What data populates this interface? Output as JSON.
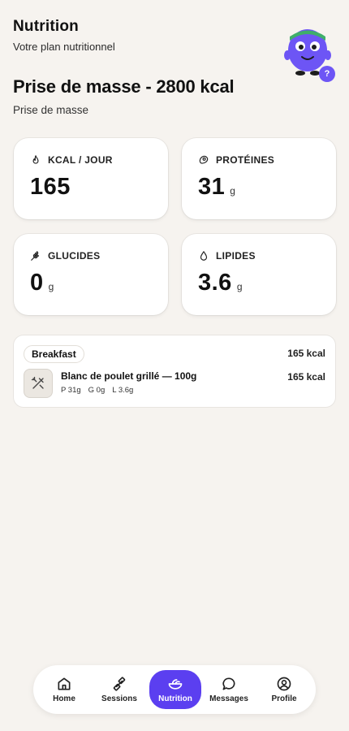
{
  "header": {
    "title": "Nutrition",
    "subtitle": "Votre plan nutritionnel",
    "help_badge": "?"
  },
  "plan": {
    "title": "Prise de masse - 2800 kcal",
    "subtitle": "Prise de masse"
  },
  "stats": [
    {
      "label": "KCAL / JOUR",
      "value": "165",
      "unit": "",
      "icon": "flame-icon"
    },
    {
      "label": "PROTÉINES",
      "value": "31",
      "unit": "g",
      "icon": "meat-icon"
    },
    {
      "label": "GLUCIDES",
      "value": "0",
      "unit": "g",
      "icon": "wheat-icon"
    },
    {
      "label": "LIPIDES",
      "value": "3.6",
      "unit": "g",
      "icon": "droplet-icon"
    }
  ],
  "meal": {
    "name": "Breakfast",
    "total": "165 kcal",
    "items": [
      {
        "name": "Blanc de poulet grillé — 100g",
        "kcal": "165 kcal",
        "protein": "P 31g",
        "carbs": "G 0g",
        "fat": "L 3.6g",
        "icon": "utensils-crossed-icon"
      }
    ]
  },
  "nav": {
    "items": [
      {
        "label": "Home",
        "icon": "home-icon"
      },
      {
        "label": "Sessions",
        "icon": "dumbbell-icon"
      },
      {
        "label": "Nutrition",
        "icon": "salad-bowl-icon"
      },
      {
        "label": "Messages",
        "icon": "chat-bubble-icon"
      },
      {
        "label": "Profile",
        "icon": "user-circle-icon"
      }
    ],
    "active": "Nutrition"
  },
  "colors": {
    "background": "#f6f3ef",
    "accent": "#5b3ff0",
    "mascot": "#6d55f5"
  }
}
